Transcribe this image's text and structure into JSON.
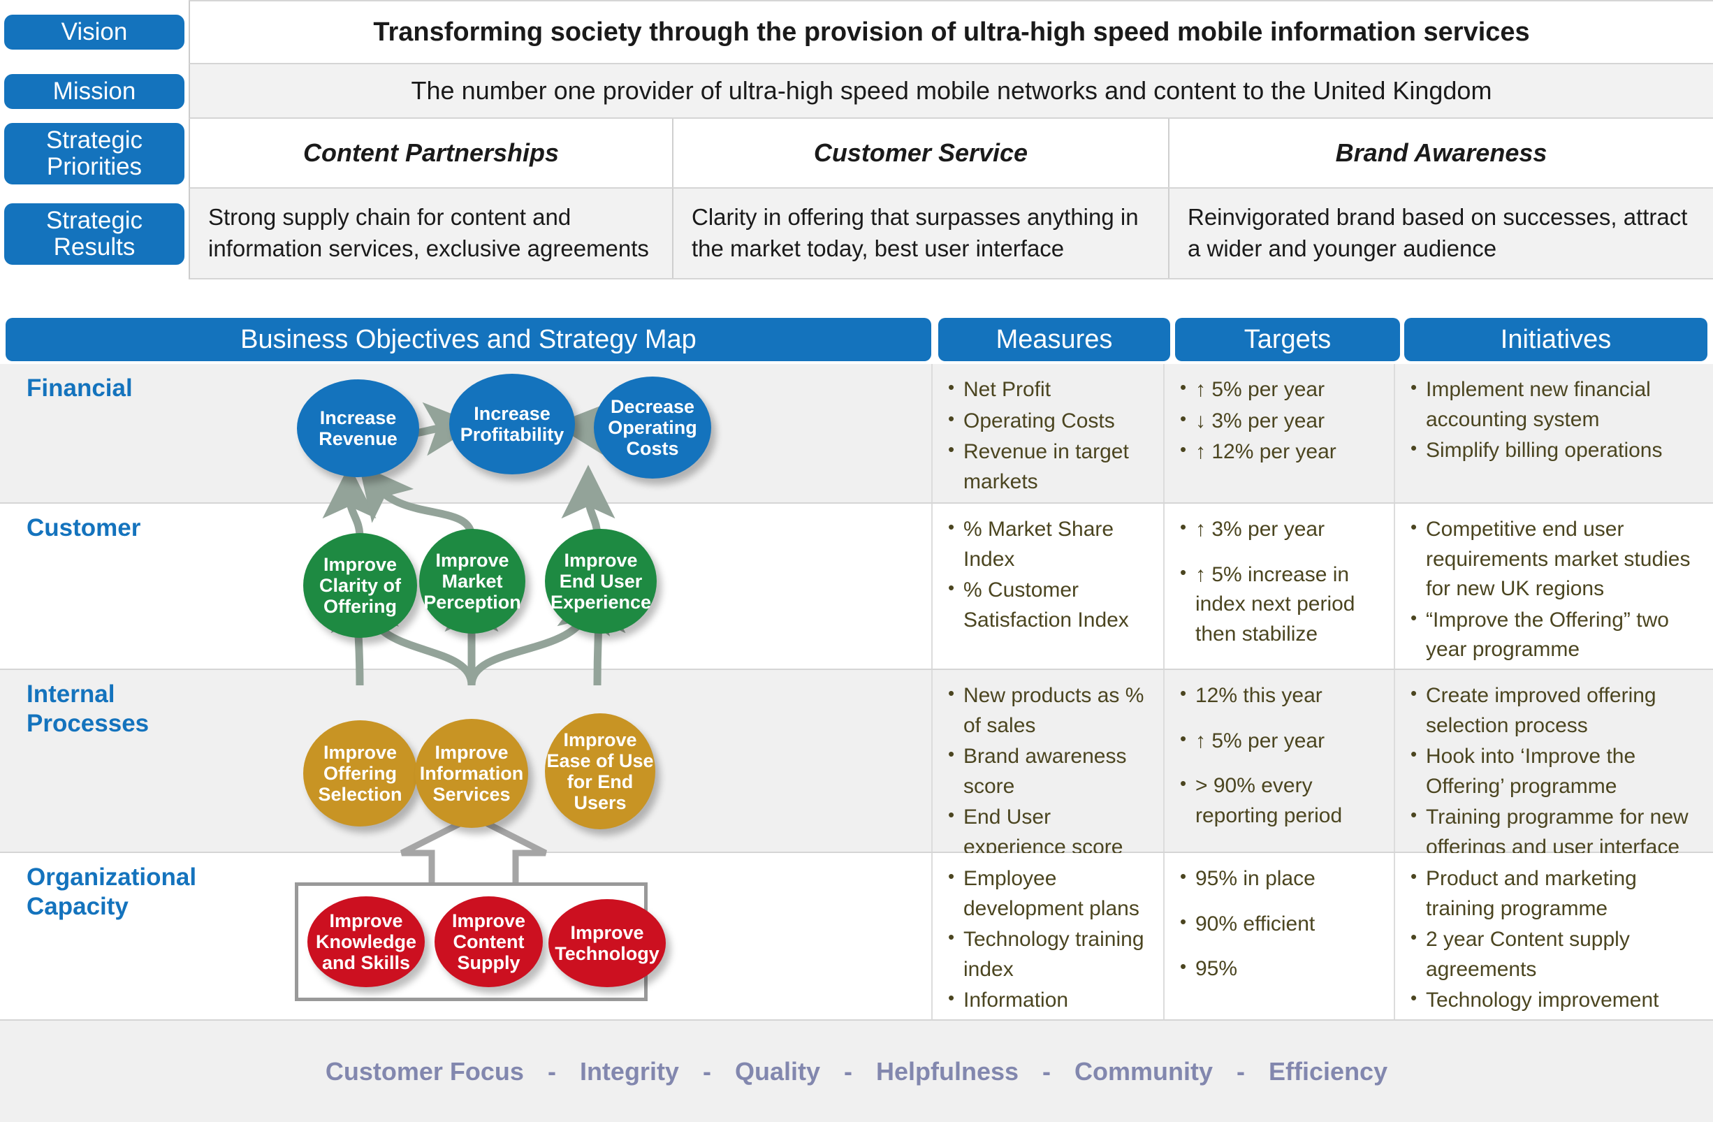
{
  "top_table": {
    "rows": [
      {
        "label": "Vision",
        "cells": [
          "Transforming society through the provision of ultra-high speed mobile information services"
        ]
      },
      {
        "label": "Mission",
        "cells": [
          "The number one provider of ultra-high speed mobile networks and content to the United Kingdom"
        ]
      },
      {
        "label": "Strategic Priorities",
        "cells": [
          "Content Partnerships",
          "Customer Service",
          "Brand Awareness"
        ]
      },
      {
        "label": "Strategic Results",
        "cells": [
          "Strong supply chain for content and information services, exclusive agreements",
          "Clarity in offering that surpasses anything in the market today, best user interface",
          "Reinvigorated brand based on successes, attract a wider and younger audience"
        ]
      }
    ]
  },
  "main_header": {
    "map": "Business Objectives and Strategy Map",
    "measures": "Measures",
    "targets": "Targets",
    "initiatives": "Initiatives"
  },
  "perspectives": {
    "financial": {
      "label": "Financial",
      "objectives": [
        "Increase Revenue",
        "Increase Profitability",
        "Decrease Operating Costs"
      ],
      "measures": [
        "Net Profit",
        "Operating Costs",
        "Revenue in target markets"
      ],
      "targets": [
        "↑ 5% per year",
        "↓ 3% per year",
        "↑ 12% per year"
      ],
      "initiatives": [
        "Implement new financial accounting system",
        "Simplify billing operations"
      ]
    },
    "customer": {
      "label": "Customer",
      "objectives": [
        "Improve Clarity of Offering",
        "Improve Market Perception",
        "Improve End User Experience"
      ],
      "measures": [
        "% Market Share Index",
        "% Customer Satisfaction Index"
      ],
      "targets": [
        "↑ 3% per year",
        "↑ 5% increase in index next period then stabilize"
      ],
      "initiatives": [
        "Competitive end user requirements market studies for new UK regions",
        "“Improve the Offering” two year programme"
      ]
    },
    "internal": {
      "label": "Internal Processes",
      "objectives": [
        "Improve Offering Selection",
        "Improve Information Services",
        "Improve Ease of Use for End Users"
      ],
      "measures": [
        "New products as % of sales",
        "Brand awareness score",
        "End User experience score"
      ],
      "targets": [
        "12% this year",
        "↑ 5% per year",
        "> 90% every reporting period"
      ],
      "initiatives": [
        "Create improved offering selection process",
        "Hook into ‘Improve the Offering’ programme",
        "Training programme for new offerings and user interface"
      ]
    },
    "organizational": {
      "label": "Organizational Capacity",
      "objectives": [
        "Improve Knowledge and Skills",
        "Improve Content Supply",
        "Improve Technology"
      ],
      "measures": [
        "Employee development plans",
        "Technology training index",
        "Information Efficiency Index"
      ],
      "targets": [
        "95% in place",
        "90% efficient",
        "95%"
      ],
      "initiatives": [
        "Product and marketing training programme",
        "2 year Content supply agreements",
        "Technology improvement programme"
      ]
    }
  },
  "values_bar": {
    "separator": "-",
    "items": [
      "Customer Focus",
      "Integrity",
      "Quality",
      "Helpfulness",
      "Community",
      "Efficiency"
    ]
  },
  "colors": {
    "brand_blue": "#1473bd",
    "financial": "#1473bd",
    "customer": "#1e8a42",
    "internal": "#c89424",
    "organizational": "#cc1020",
    "connector": "#93a399",
    "values_text": "#8287ae",
    "bullet_text": "#4b4520"
  }
}
